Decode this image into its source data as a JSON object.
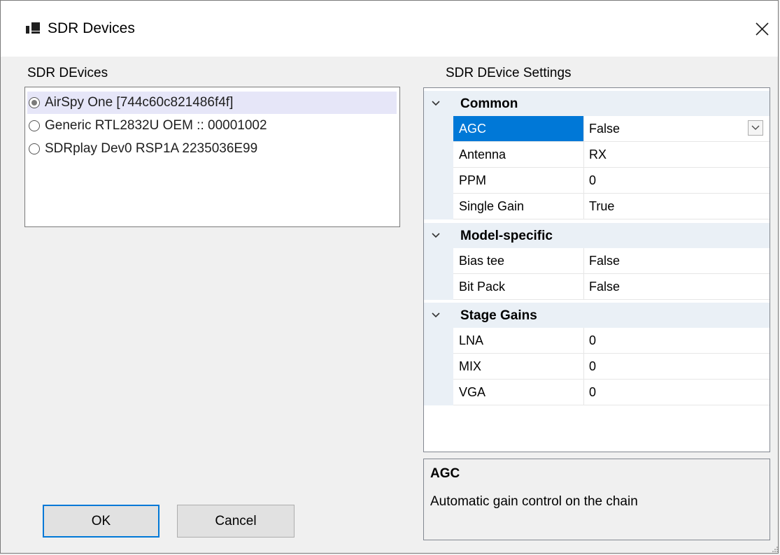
{
  "window": {
    "title": "SDR Devices"
  },
  "devices": {
    "label": "SDR DEvices",
    "items": [
      {
        "label": "AirSpy One [744c60c821486f4f]",
        "selected": true
      },
      {
        "label": "Generic RTL2832U OEM :: 00001002",
        "selected": false
      },
      {
        "label": "SDRplay Dev0 RSP1A 2235036E99",
        "selected": false
      }
    ]
  },
  "settings": {
    "label": "SDR DEvice Settings",
    "categories": [
      {
        "name": "Common",
        "properties": [
          {
            "name": "AGC",
            "value": "False"
          },
          {
            "name": "Antenna",
            "value": "RX"
          },
          {
            "name": "PPM",
            "value": "0"
          },
          {
            "name": "Single Gain",
            "value": "True"
          }
        ]
      },
      {
        "name": "Model-specific",
        "properties": [
          {
            "name": "Bias tee",
            "value": "False"
          },
          {
            "name": "Bit Pack",
            "value": "False"
          }
        ]
      },
      {
        "name": "Stage Gains",
        "properties": [
          {
            "name": "LNA",
            "value": "0"
          },
          {
            "name": "MIX",
            "value": "0"
          },
          {
            "name": "VGA",
            "value": "0"
          }
        ]
      }
    ],
    "selected_property": "AGC"
  },
  "help": {
    "title": "AGC",
    "description": "Automatic gain control on the chain"
  },
  "buttons": {
    "ok": "OK",
    "cancel": "Cancel"
  },
  "colors": {
    "selection": "#0078d7",
    "category_background": "#eaf0f6",
    "list_selection": "#e6e6f8"
  },
  "icons": {
    "app": "window-app-icon",
    "close": "close-icon",
    "expand": "chevron-down-icon",
    "dropdown": "chevron-down-icon"
  }
}
